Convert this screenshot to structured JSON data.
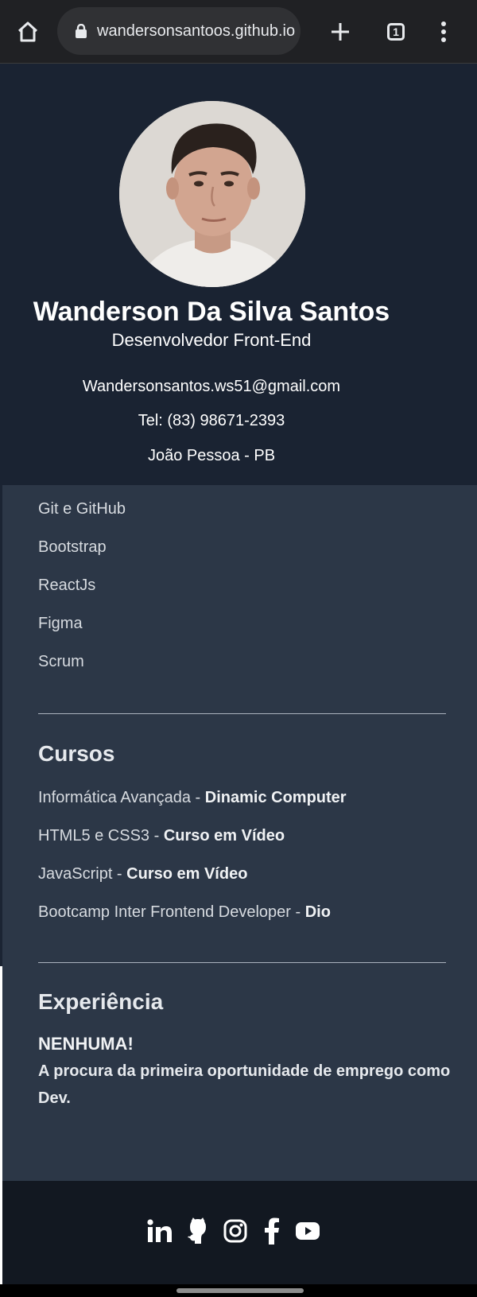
{
  "browser": {
    "url": "wandersonsantoos.github.io",
    "tab_count": "1"
  },
  "profile": {
    "name": "Wanderson Da Silva Santos",
    "role": "Desenvolvedor Front-End",
    "email": "Wandersonsantos.ws51@gmail.com",
    "phone": "Tel: (83) 98671-2393",
    "location": "João Pessoa - PB"
  },
  "skills": [
    "Git e GitHub",
    "Bootstrap",
    "ReactJs",
    "Figma",
    "Scrum"
  ],
  "courses": {
    "title": "Cursos",
    "items": [
      {
        "name": "Informática Avançada",
        "sep": " - ",
        "org": "Dinamic Computer"
      },
      {
        "name": "HTML5 e CSS3",
        "sep": " - ",
        "org": "Curso em Vídeo"
      },
      {
        "name": "JavaScript",
        "sep": " - ",
        "org": "Curso em Vídeo"
      },
      {
        "name": "Bootcamp Inter Frontend Developer",
        "sep": " - ",
        "org": "Dio"
      }
    ]
  },
  "experience": {
    "title": "Experiência",
    "headline": "NENHUMA!",
    "text": "A procura da primeira oportunidade de emprego como Dev."
  },
  "social": [
    "linkedin-icon",
    "github-icon",
    "instagram-icon",
    "facebook-icon",
    "youtube-icon"
  ],
  "colors": {
    "header_bg": "#1a2332",
    "content_bg": "#2c3747",
    "footer_bg": "#121821",
    "browser_bar": "#202124"
  }
}
